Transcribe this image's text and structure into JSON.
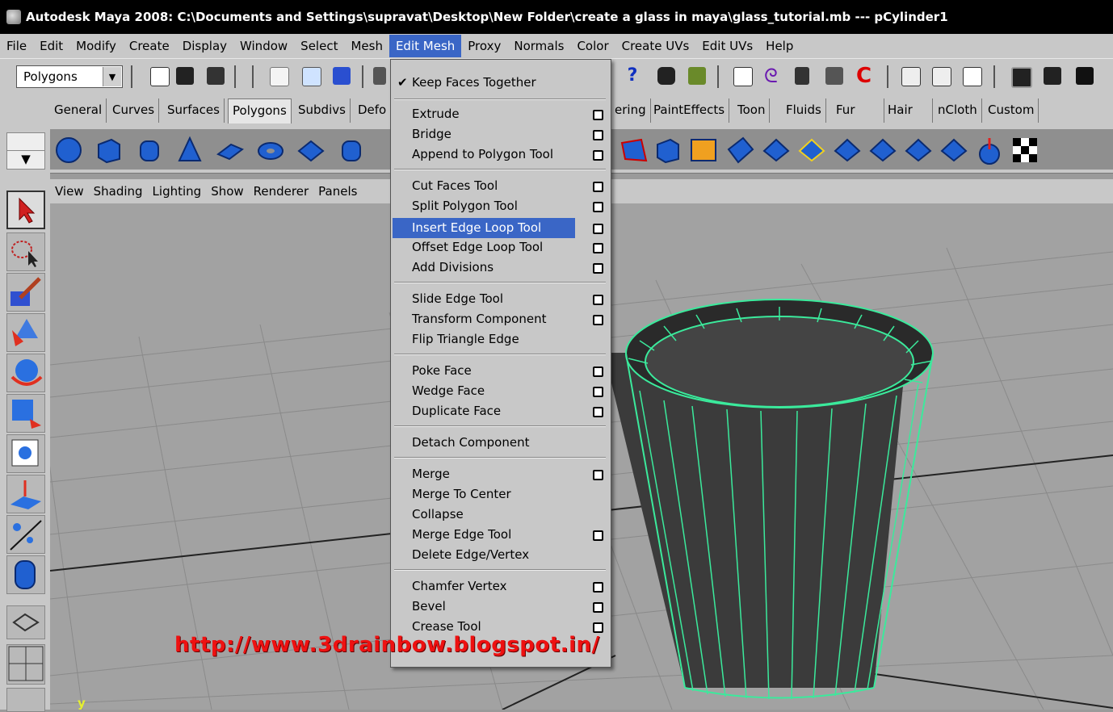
{
  "window": {
    "title": "Autodesk Maya 2008: C:\\Documents and Settings\\supravat\\Desktop\\New Folder\\create a glass in maya\\glass_tutorial.mb  ---  pCylinder1"
  },
  "menubar": [
    "File",
    "Edit",
    "Modify",
    "Create",
    "Display",
    "Window",
    "Select",
    "Mesh",
    "Edit Mesh",
    "Proxy",
    "Normals",
    "Color",
    "Create UVs",
    "Edit UVs",
    "Help"
  ],
  "active_menu": "Edit Mesh",
  "mode_select": {
    "value": "Polygons"
  },
  "shelf_tabs": [
    "General",
    "Curves",
    "Surfaces",
    "Polygons",
    "Subdivs",
    "Defo",
    "ering",
    "PaintEffects",
    "Toon",
    "Fluids",
    "Fur",
    "Hair",
    "nCloth",
    "Custom"
  ],
  "selected_shelf_tab": "Polygons",
  "panel_menu": [
    "View",
    "Shading",
    "Lighting",
    "Show",
    "Renderer",
    "Panels"
  ],
  "edit_mesh_menu": {
    "keep_faces_together": "Keep Faces Together",
    "items": [
      {
        "label": "Extrude",
        "option": true
      },
      {
        "label": "Bridge",
        "option": true
      },
      {
        "label": "Append to Polygon Tool",
        "option": true
      },
      {
        "label": "Cut Faces Tool",
        "option": true
      },
      {
        "label": "Split Polygon Tool",
        "option": true
      },
      {
        "label": "Insert Edge Loop Tool",
        "option": true,
        "highlighted": true
      },
      {
        "label": "Offset Edge Loop Tool",
        "option": true
      },
      {
        "label": "Add Divisions",
        "option": true
      },
      {
        "label": "Slide Edge Tool",
        "option": true
      },
      {
        "label": "Transform Component",
        "option": true
      },
      {
        "label": "Flip Triangle Edge",
        "option": false
      },
      {
        "label": "Poke Face",
        "option": true
      },
      {
        "label": "Wedge Face",
        "option": true
      },
      {
        "label": "Duplicate Face",
        "option": true
      },
      {
        "label": "Detach Component",
        "option": false
      },
      {
        "label": "Merge",
        "option": true
      },
      {
        "label": "Merge To Center",
        "option": false
      },
      {
        "label": "Collapse",
        "option": false
      },
      {
        "label": "Merge Edge Tool",
        "option": true
      },
      {
        "label": "Delete Edge/Vertex",
        "option": false
      },
      {
        "label": "Chamfer Vertex",
        "option": true
      },
      {
        "label": "Bevel",
        "option": true
      },
      {
        "label": "Crease Tool",
        "option": true
      }
    ]
  },
  "watermark": "http://www.3drainbow.blogspot.in/",
  "axis_label": "y",
  "colors": {
    "menu_highlight": "#3a66c6",
    "wireframe": "#3bea9c",
    "watermark": "#ee1111"
  }
}
